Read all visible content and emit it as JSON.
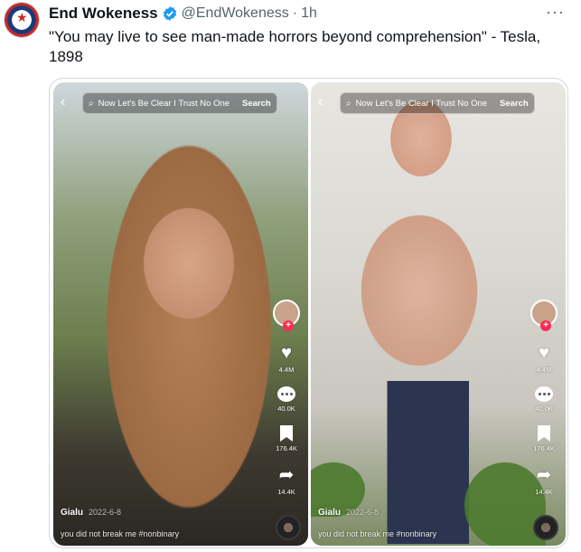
{
  "tweet": {
    "author_name": "End Wokeness",
    "handle": "@EndWokeness",
    "separator": "·",
    "timestamp": "1h",
    "more": "···",
    "text": "\"You may live to see man-made horrors beyond comprehension\" - Tesla, 1898",
    "verified_color": "#1d9bf0"
  },
  "videos": [
    {
      "search_query": "Now Let's Be Clear I Trust No One",
      "search_button": "Search",
      "back": "‹",
      "likes": "4.4M",
      "comments": "40.0K",
      "saves": "176.4K",
      "shares": "14.4K",
      "username": "Gialu",
      "date": "2022-6-8",
      "description": "you did not break me #nonbinary"
    },
    {
      "search_query": "Now Let's Be Clear I Trust No One",
      "search_button": "Search",
      "back": "‹",
      "likes": "4.4M",
      "comments": "40.0K",
      "saves": "176.4K",
      "shares": "14.4K",
      "username": "Gialu",
      "date": "2022-6-8",
      "description": "you did not break me #nonbinary"
    }
  ],
  "icons": {
    "search": "search-icon",
    "heart": "heart-icon",
    "comment": "comment-icon",
    "bookmark": "bookmark-icon",
    "share": "share-icon",
    "plus": "+"
  }
}
